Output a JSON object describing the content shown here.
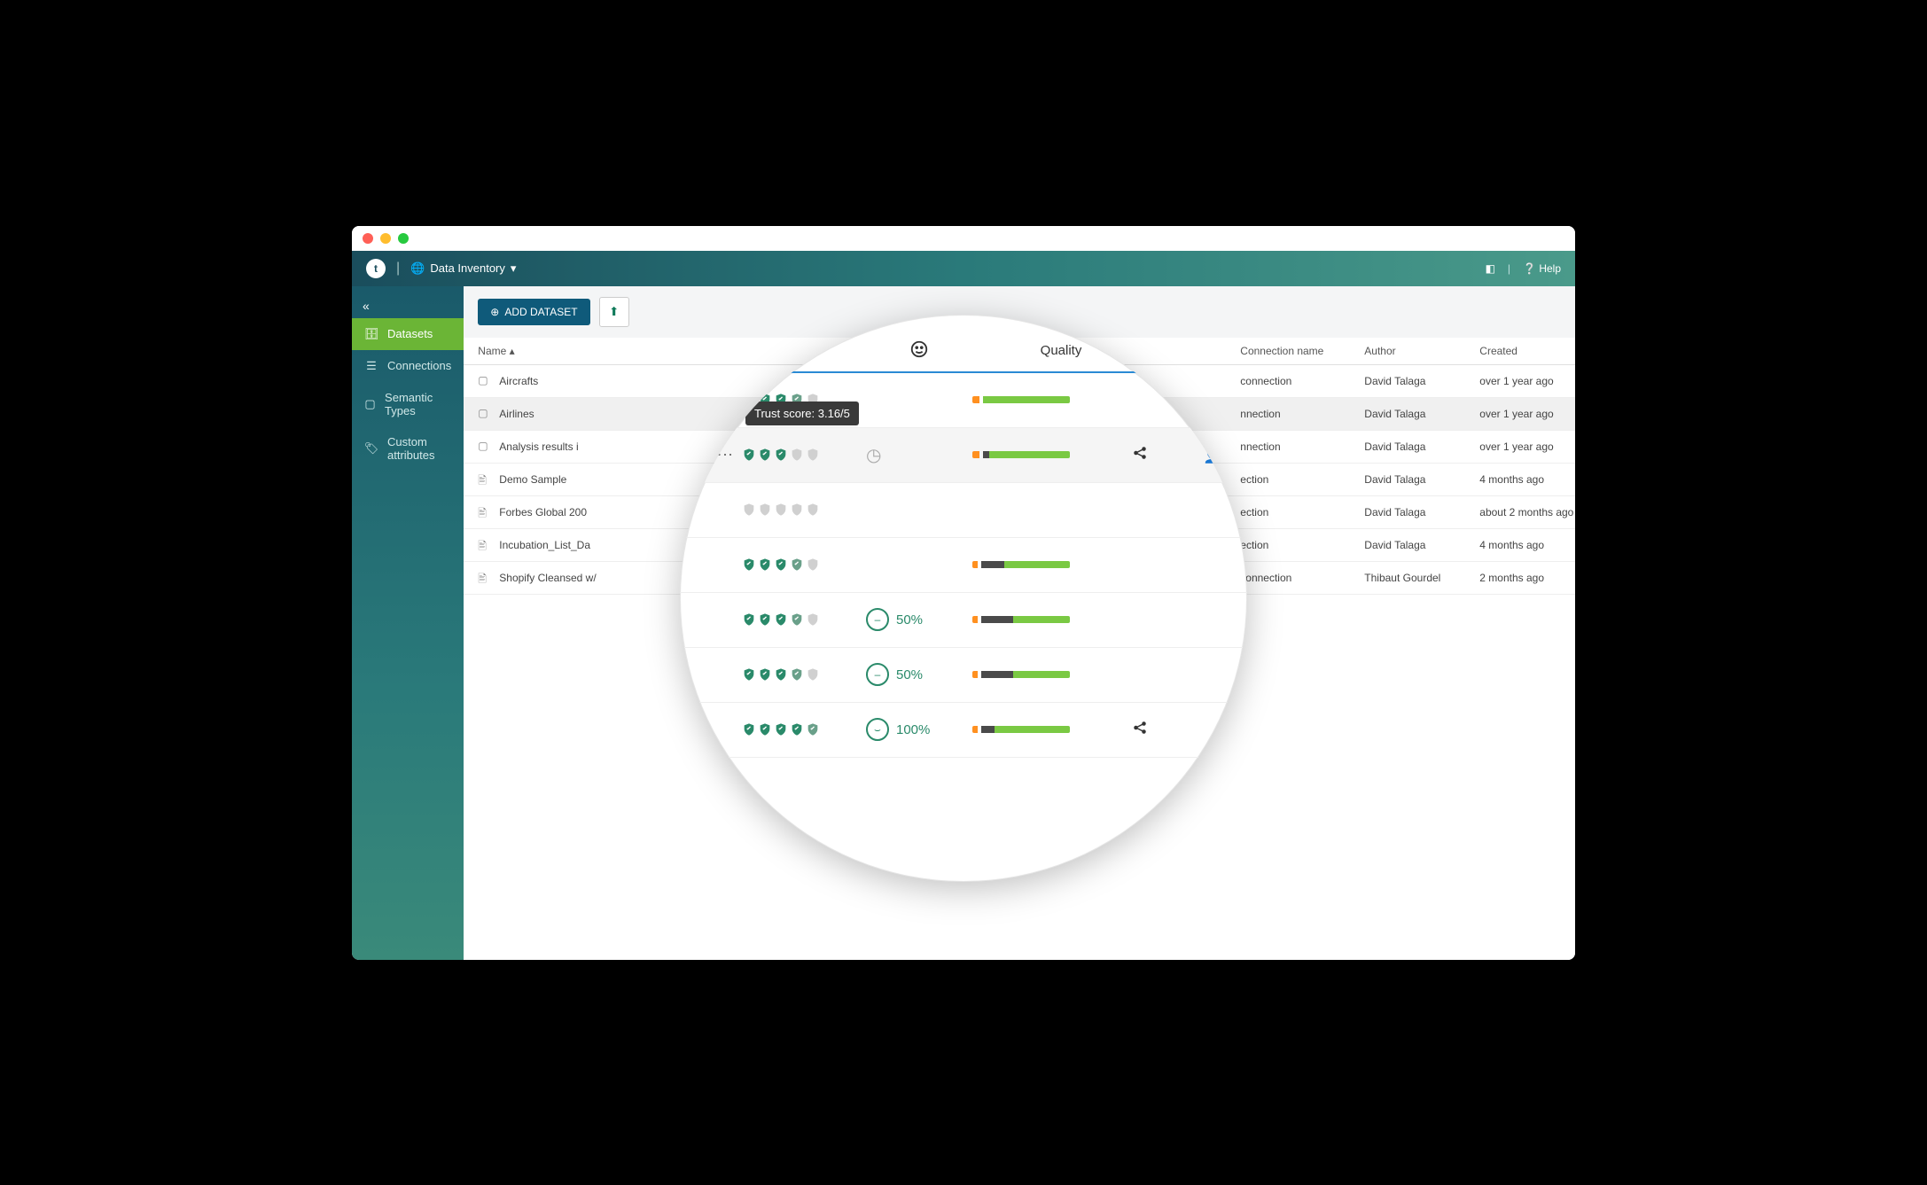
{
  "breadcrumb": "Data Inventory",
  "help_label": "Help",
  "sidebar": {
    "collapse": "«",
    "items": [
      {
        "label": "Datasets",
        "active": true
      },
      {
        "label": "Connections",
        "active": false
      },
      {
        "label": "Semantic Types",
        "active": false
      },
      {
        "label": "Custom attributes",
        "active": false
      }
    ]
  },
  "toolbar": {
    "add_label": "ADD DATASET"
  },
  "columns": {
    "name": "Name",
    "trust": "",
    "usage": "",
    "quality": "",
    "share": "",
    "owner": "",
    "connection": "Connection name",
    "author": "Author",
    "created": "Created"
  },
  "rows": [
    {
      "name": "Aircrafts",
      "connection": "connection",
      "author": "David Talaga",
      "created": "over 1 year ago"
    },
    {
      "name": "Airlines",
      "connection": "nnection",
      "author": "David Talaga",
      "created": "over 1 year ago",
      "selected": true
    },
    {
      "name": "Analysis results i",
      "connection": "nnection",
      "author": "David Talaga",
      "created": "over 1 year ago"
    },
    {
      "name": "Demo Sample",
      "connection": "ection",
      "author": "David Talaga",
      "created": "4 months ago"
    },
    {
      "name": "Forbes Global 200",
      "connection": "ection",
      "author": "David Talaga",
      "created": "about 2 months ago"
    },
    {
      "name": "Incubation_List_Da",
      "connection": "ection",
      "author": "David Talaga",
      "created": "4 months ago"
    },
    {
      "name": "Shopify Cleansed w/",
      "connection": "connection",
      "author": "Thibaut Gourdel",
      "created": "2 months ago"
    }
  ],
  "magnifier": {
    "headers": {
      "trust": "",
      "usage": "",
      "quality": "Quality",
      "share": ""
    },
    "tooltip": "Trust score: 3.16/5",
    "rows": [
      {
        "shields": [
          1,
          1,
          1,
          0.5,
          0
        ],
        "usage": null,
        "quality": {
          "orange": 8,
          "dark": 0,
          "green": 92
        },
        "share": false,
        "actions": false
      },
      {
        "shields": [
          1,
          1,
          1,
          0,
          0
        ],
        "usage": "clock",
        "quality": {
          "orange": 8,
          "dark": 6,
          "green": 86
        },
        "share": true,
        "actions": true
      },
      {
        "shields": [
          0,
          0,
          0,
          0,
          0
        ],
        "usage": null,
        "quality": null,
        "share": false,
        "actions": false
      },
      {
        "shields": [
          1,
          1,
          1,
          0.5,
          0
        ],
        "usage": null,
        "quality": {
          "orange": 6,
          "dark": 24,
          "green": 70
        },
        "share": false,
        "actions": false
      },
      {
        "shields": [
          1,
          1,
          1,
          0.5,
          0
        ],
        "usage": "50%",
        "quality": {
          "orange": 6,
          "dark": 34,
          "green": 60
        },
        "share": false,
        "actions": false
      },
      {
        "shields": [
          1,
          1,
          1,
          0.5,
          0
        ],
        "usage": "50%",
        "quality": {
          "orange": 6,
          "dark": 34,
          "green": 60
        },
        "share": false,
        "actions": false
      },
      {
        "shields": [
          1,
          1,
          1,
          1,
          0.5
        ],
        "usage": "100%",
        "quality": {
          "orange": 6,
          "dark": 14,
          "green": 80
        },
        "share": true,
        "actions": false
      }
    ]
  }
}
